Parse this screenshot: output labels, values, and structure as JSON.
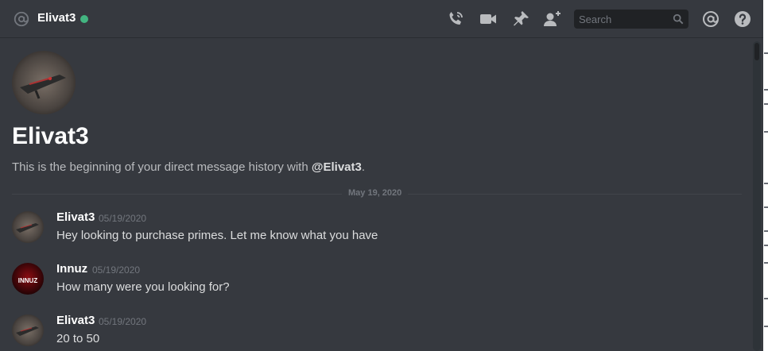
{
  "header": {
    "dm_name": "Elivat3",
    "status": "online",
    "status_color": "#43b581",
    "icons": [
      "at-icon",
      "start-voice-call-icon",
      "start-video-call-icon",
      "pinned-messages-icon",
      "add-friend-to-dm-icon",
      "mentions-icon",
      "help-icon"
    ],
    "search": {
      "placeholder": "Search"
    }
  },
  "welcome": {
    "title": "Elivat3",
    "text_prefix": "This is the beginning of your direct message history with ",
    "mention": "@Elivat3",
    "text_suffix": "."
  },
  "divider": {
    "label": "May 19, 2020"
  },
  "messages": [
    {
      "author": "Elivat3",
      "timestamp": "05/19/2020",
      "content": "Hey looking to purchase primes. Let me know what you have"
    },
    {
      "author": "Innuz",
      "timestamp": "05/19/2020",
      "content": "How many were you looking for?",
      "avatar_text": "INNUZ"
    },
    {
      "author": "Elivat3",
      "timestamp": "05/19/2020",
      "content": "20 to 50"
    }
  ],
  "colors": {
    "background": "#36393f",
    "header_border": "#2a2c31",
    "text": "#dcddde",
    "muted": "#72767d",
    "icon": "#b9bbbe"
  }
}
